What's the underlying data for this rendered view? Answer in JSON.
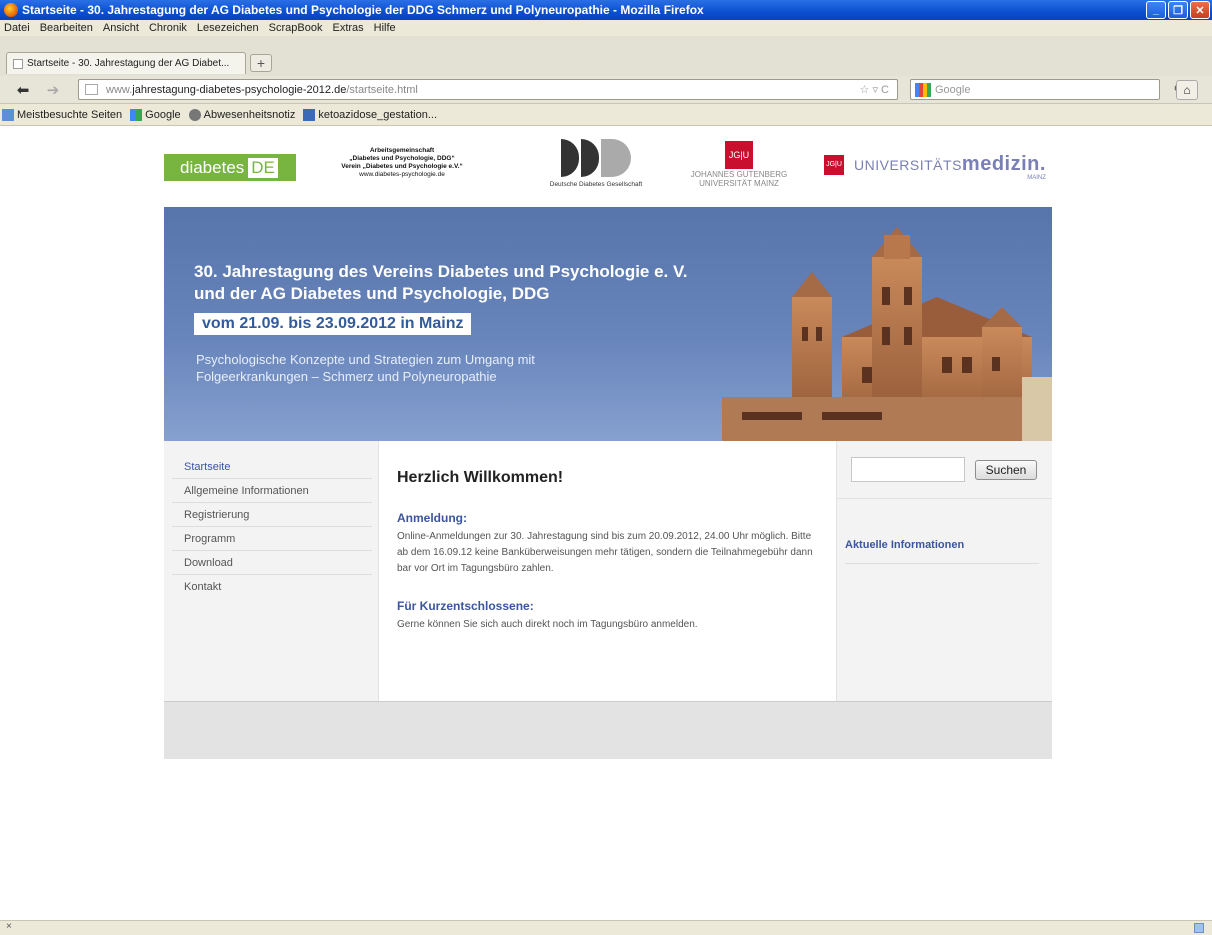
{
  "window": {
    "title": "Startseite - 30. Jahrestagung der AG Diabetes und Psychologie der DDG Schmerz und Polyneuropathie - Mozilla Firefox"
  },
  "menu": [
    "Datei",
    "Bearbeiten",
    "Ansicht",
    "Chronik",
    "Lesezeichen",
    "ScrapBook",
    "Extras",
    "Hilfe"
  ],
  "tab": {
    "label": "Startseite - 30. Jahrestagung der AG Diabet...",
    "new_tab": "+"
  },
  "nav": {
    "url_prefix": "www.",
    "url_domain": "jahrestagung-diabetes-psychologie-2012.de",
    "url_path": "/startseite.html",
    "url_end": "☆ ▿ C",
    "search_placeholder": "Google"
  },
  "bookmarks": [
    "Meistbesuchte Seiten",
    "Google",
    "Abwesenheitsnotiz",
    "ketoazidose_gestation..."
  ],
  "logos": {
    "diabetes_de": "diabetes",
    "diabetes_de_box": "DE",
    "ag_line1": "Arbeitsgemeinschaft",
    "ag_line2": "„Diabetes und Psychologie, DDG“",
    "ag_line3": "Verein „Diabetes und Psychologie e.V.“",
    "ag_web": "www.diabetes-psychologie.de",
    "ddg_text": "Deutsche Diabetes Gesellschaft",
    "jgu": "JG|U",
    "jgu_name1": "JOHANNES GUTENBERG",
    "jgu_name2": "UNIVERSITÄT MAINZ",
    "uni_prefix": "UNIVERSITÄTS",
    "uni_bold": "medizin.",
    "uni_mainz": "MAINZ"
  },
  "banner": {
    "title_line1": "30. Jahrestagung des Vereins Diabetes und Psychologie e. V.",
    "title_line2": "und der AG Diabetes und Psychologie, DDG",
    "date": "vom 21.09. bis 23.09.2012 in Mainz",
    "sub_line1": "Psychologische Konzepte und Strategien zum Umgang mit",
    "sub_line2": "Folgeerkrankungen – Schmerz und Polyneuropathie"
  },
  "sidebar": {
    "items": [
      {
        "label": "Startseite"
      },
      {
        "label": "Allgemeine Informationen"
      },
      {
        "label": "Registrierung"
      },
      {
        "label": "Programm"
      },
      {
        "label": "Download"
      },
      {
        "label": "Kontakt"
      }
    ]
  },
  "main": {
    "heading": "Herzlich Willkommen!",
    "section1_title": "Anmeldung:",
    "section1_text": "Online-Anmeldungen zur 30. Jahrestagung sind bis zum 20.09.2012, 24.00 Uhr möglich. Bitte ab dem 16.09.12 keine Banküberweisungen mehr tätigen, sondern die Teilnahmegebühr dann bar vor Ort im Tagungsbüro zahlen.",
    "section2_title": "Für Kurzentschlossene:",
    "section2_text": "Gerne können Sie sich auch direkt noch im Tagungsbüro anmelden."
  },
  "right": {
    "search_button": "Suchen",
    "news_heading": "Aktuelle Informationen"
  },
  "status": {
    "text": "×"
  },
  "colors": {
    "accent": "#3b55a0",
    "banner": "#5e7cb4",
    "green": "#77b540",
    "red": "#c8102e"
  }
}
